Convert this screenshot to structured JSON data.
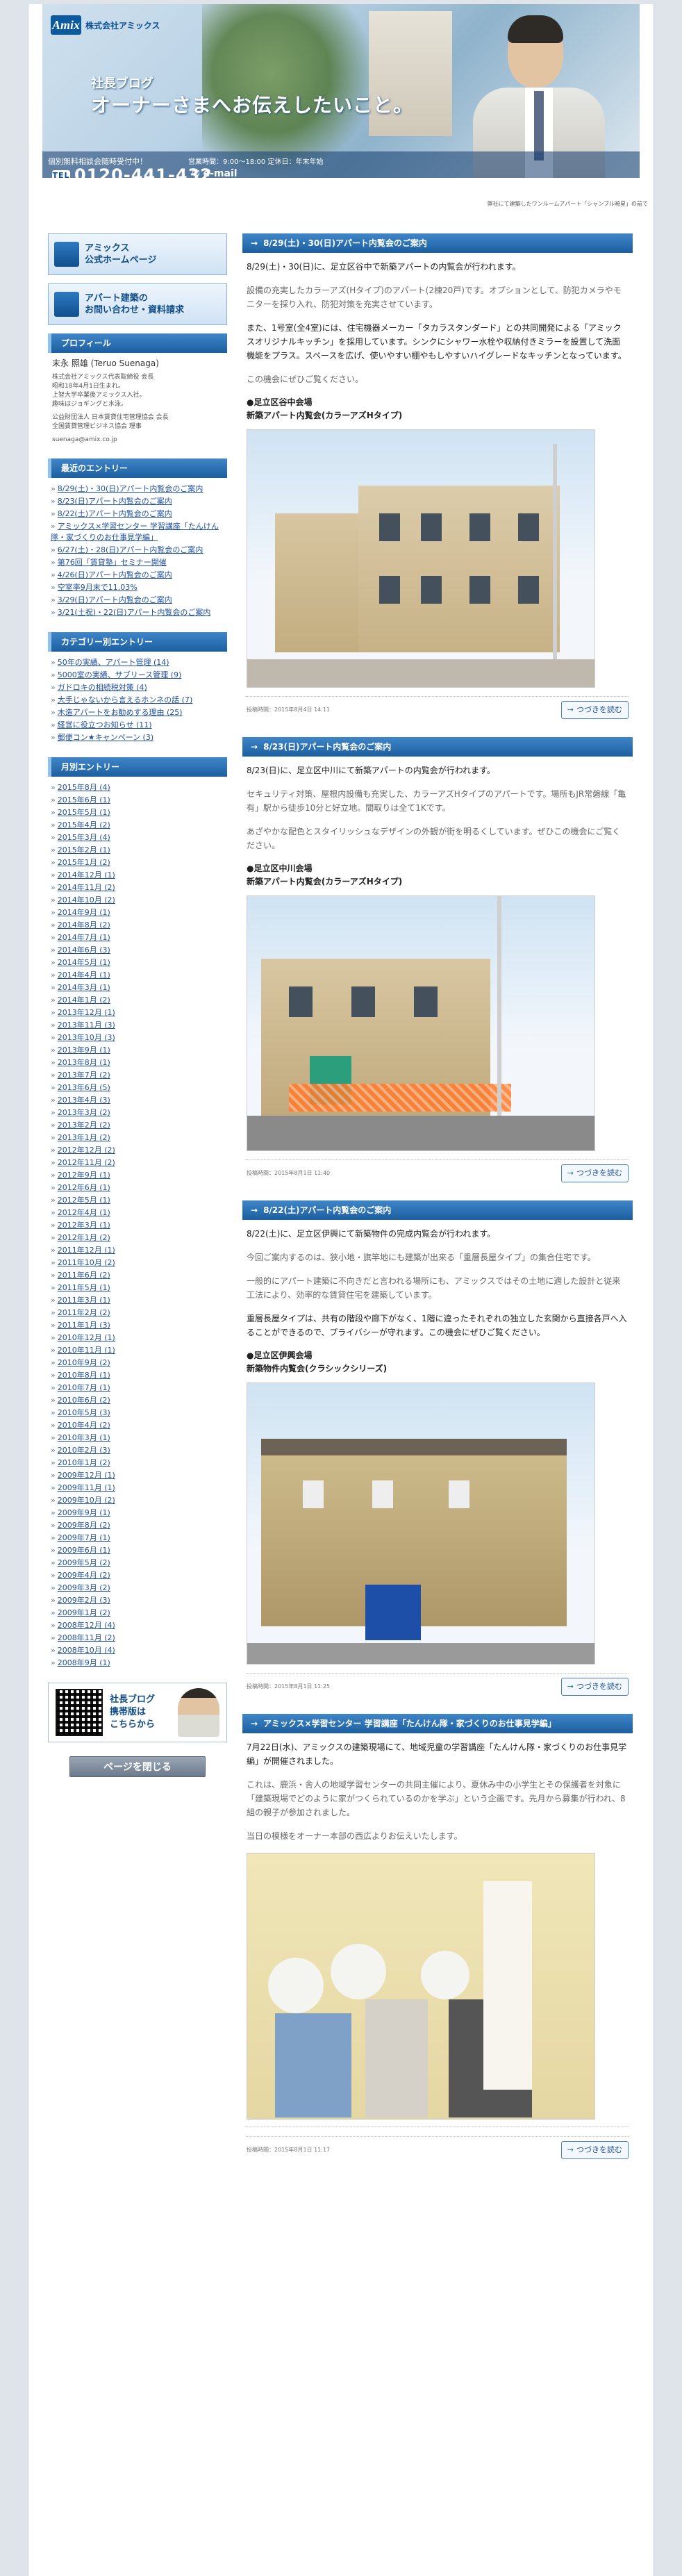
{
  "header": {
    "logo_mark": "Amix",
    "logo_name": "Amix",
    "company": "株式会社アミックス",
    "blog_sub": "社長ブログ",
    "blog_title": "オーナーさまへお伝えしたいこと。",
    "contact_line": "個別無料相談会随時受付中！",
    "hours": "営業時間：9:00～18:00  定休日：年末年始",
    "tel_label": "TEL",
    "tel": "0120-441-432",
    "email_label": "e-mail",
    "caption": "弊社にて建築したワンルームアパート「シャンブル暁星」の前で"
  },
  "sidebar": {
    "promo1": {
      "line1": "アミックス",
      "line2": "公式ホームページ"
    },
    "promo2": {
      "line1": "アパート建築の",
      "line2": "お問い合わせ・資料請求"
    },
    "profile": {
      "heading": "プロフィール",
      "name": "末永 照雄 (Teruo Suenaga)",
      "lines": [
        "株式会社アミックス代表取締役 会長",
        "昭和18年4月1日生まれ。",
        "上智大学卒業後アミックス入社。",
        "趣味はジョギングと水泳。"
      ],
      "assoc": [
        "公益財団法人 日本賃貸住宅管理協会 会長",
        "全国賃貸管理ビジネス協会 理事"
      ],
      "email": "suenaga@amix.co.jp"
    },
    "recent": {
      "heading": "最近のエントリー",
      "items": [
        "8/29(土)・30(日)アパート内覧会のご案内",
        "8/23(日)アパート内覧会のご案内",
        "8/22(土)アパート内覧会のご案内",
        "アミックス×学習センター 学習講座「たんけん隊・家づくりのお仕事見学編」",
        "6/27(土)・28(日)アパート内覧会のご案内",
        "第76回「賃貸塾」セミナー開催",
        "4/26(日)アパート内覧会のご案内",
        "空室率9月末で11.03%",
        "3/29(日)アパート内覧会のご案内",
        "3/21(土祝)・22(日)アパート内覧会のご案内"
      ]
    },
    "categories": {
      "heading": "カテゴリー別エントリー",
      "items": [
        "50年の実績、アパート管理 (14)",
        "5000室の実績、サブリース管理 (9)",
        "ガドロキの相続税対策 (4)",
        "大手じゃないから言えるホンネの話 (7)",
        "木造アパートをお勧めする理由 (25)",
        "経営に役立つお知らせ (11)",
        "郵便コン★キャンペーン (3)"
      ]
    },
    "monthly": {
      "heading": "月別エントリー",
      "items": [
        "2015年8月 (4)",
        "2015年6月 (1)",
        "2015年5月 (1)",
        "2015年4月 (2)",
        "2015年3月 (4)",
        "2015年2月 (1)",
        "2015年1月 (2)",
        "2014年12月 (1)",
        "2014年11月 (2)",
        "2014年10月 (2)",
        "2014年9月 (1)",
        "2014年8月 (2)",
        "2014年7月 (1)",
        "2014年6月 (3)",
        "2014年5月 (1)",
        "2014年4月 (1)",
        "2014年3月 (1)",
        "2014年1月 (2)",
        "2013年12月 (1)",
        "2013年11月 (3)",
        "2013年10月 (3)",
        "2013年9月 (1)",
        "2013年8月 (1)",
        "2013年7月 (2)",
        "2013年6月 (5)",
        "2013年4月 (3)",
        "2013年3月 (2)",
        "2013年2月 (2)",
        "2013年1月 (2)",
        "2012年12月 (2)",
        "2012年11月 (2)",
        "2012年9月 (1)",
        "2012年6月 (1)",
        "2012年5月 (1)",
        "2012年4月 (1)",
        "2012年3月 (1)",
        "2012年1月 (2)",
        "2011年12月 (1)",
        "2011年10月 (2)",
        "2011年6月 (2)",
        "2011年5月 (1)",
        "2011年3月 (1)",
        "2011年2月 (2)",
        "2011年1月 (3)",
        "2010年12月 (1)",
        "2010年11月 (1)",
        "2010年9月 (2)",
        "2010年8月 (1)",
        "2010年7月 (1)",
        "2010年6月 (2)",
        "2010年5月 (3)",
        "2010年4月 (2)",
        "2010年3月 (1)",
        "2010年2月 (3)",
        "2010年1月 (2)",
        "2009年12月 (1)",
        "2009年11月 (1)",
        "2009年10月 (2)",
        "2009年9月 (1)",
        "2009年8月 (2)",
        "2009年7月 (1)",
        "2009年6月 (1)",
        "2009年5月 (2)",
        "2009年4月 (2)",
        "2009年3月 (2)",
        "2009年2月 (3)",
        "2009年1月 (2)",
        "2008年12月 (4)",
        "2008年11月 (2)",
        "2008年10月 (4)",
        "2008年9月 (1)"
      ]
    },
    "mobile": {
      "line1": "社長ブログ",
      "line2": "携帯版は",
      "line3": "こちらから"
    },
    "close_button": "ページを閉じる"
  },
  "posts": [
    {
      "title": "8/29(土)・30(日)アパート内覧会のご案内",
      "p1": "8/29(土)・30(日)に、足立区谷中で新築アパートの内覧会が行われます。",
      "p2": "設備の充実したカラーアズ(Hタイプ)のアパート(2棟20戸)です。オプションとして、防犯カメラやモニターを採り入れ、防犯対策を充実させています。",
      "p3": "また、1号室(全4室)には、住宅機器メーカー「タカラスタンダード」との共同開発による「アミックスオリジナルキッチン」を採用しています。シンクにシャワー水栓や収納付きミラーを設置して洗面機能をプラス。スペースを広げ、使いやすい棚やもしやすいハイグレードなキッチンとなっています。",
      "p4": "この機会にぜひご覧ください。",
      "loc1": "●足立区谷中会場",
      "loc2": "新築アパート内覧会(カラーアズHタイプ)",
      "posted": "投稿時間：2015年8月4日 14:11",
      "more": "つづきを読む"
    },
    {
      "title": "8/23(日)アパート内覧会のご案内",
      "p1": "8/23(日)に、足立区中川にて新築アパートの内覧会が行われます。",
      "p2": "セキュリティ対策、屋根内設備も充実した、カラーアズHタイプのアパートです。場所もJR常磐線「亀有」駅から徒歩10分と好立地。間取りは全て1Kです。",
      "p3": "あざやかな配色とスタイリッシュなデザインの外観が街を明るくしています。ぜひこの機会にご覧ください。",
      "loc1": "●足立区中川会場",
      "loc2": "新築アパート内覧会(カラーアズHタイプ)",
      "posted": "投稿時間：2015年8月1日 11:40",
      "more": "つづきを読む"
    },
    {
      "title": "8/22(土)アパート内覧会のご案内",
      "p1": "8/22(土)に、足立区伊興にて新築物件の完成内覧会が行われます。",
      "p2": "今回ご案内するのは、狭小地・旗竿地にも建築が出来る「重層長屋タイプ」の集合住宅です。",
      "p3": "一般的にアパート建築に不向きだと言われる場所にも、アミックスではその土地に適した設計と従来工法により、効率的な賃貸住宅を建築しています。",
      "p4": "重層長屋タイプは、共有の階段や廊下がなく、1階に違ったそれぞれの独立した玄関から直接各戸へ入ることができるので、プライバシーが守れます。この機会にぜひご覧ください。",
      "loc1": "●足立区伊興会場",
      "loc2": "新築物件内覧会(クラシックシリーズ)",
      "posted": "投稿時間：2015年8月1日 11:25",
      "more": "つづきを読む"
    },
    {
      "title": "アミックス×学習センター 学習講座「たんけん隊・家づくりのお仕事見学編」",
      "p1": "7月22日(水)、アミックスの建築現場にて、地域児童の学習講座「たんけん隊・家づくりのお仕事見学編」が開催されました。",
      "p2": "これは、鹿浜・舎人の地域学習センターの共同主催により、夏休み中の小学生とその保護者を対象に「建築現場でどのように家がつくられているのかを学ぶ」という企画です。先月から募集が行われ、8組の親子が参加されました。",
      "p3": "当日の模様をオーナー本部の西広よりお伝えいたします。",
      "posted": "投稿時間：2015年8月1日 11:17",
      "more": "つづきを読む"
    }
  ]
}
